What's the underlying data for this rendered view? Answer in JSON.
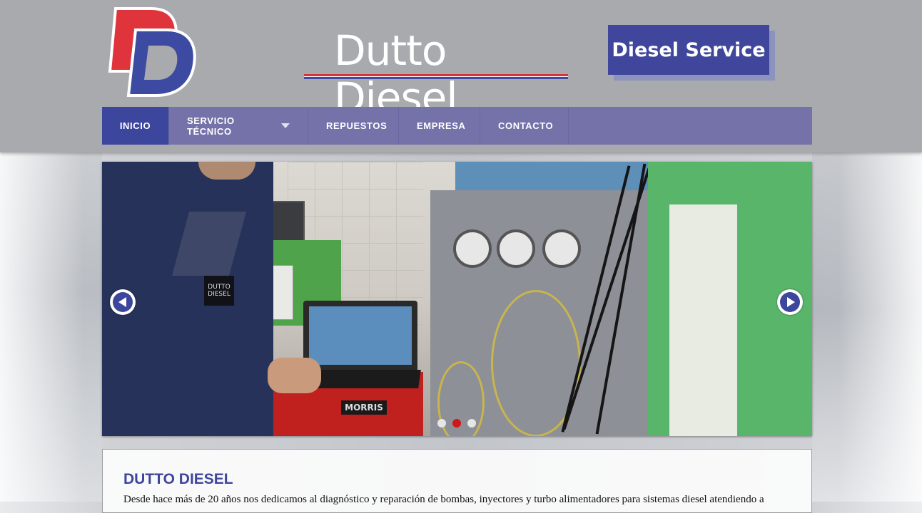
{
  "site": {
    "logo_text": "Dutto Diesel",
    "logo_mark": "DD",
    "badge": "Diesel Service"
  },
  "nav": {
    "items": [
      {
        "label": "INICIO"
      },
      {
        "label": "SERVICIO TÉCNICO"
      },
      {
        "label": "REPUESTOS"
      },
      {
        "label": "EMPRESA"
      },
      {
        "label": "CONTACTO"
      }
    ]
  },
  "slider": {
    "slides": 3,
    "active_slide": 2,
    "cart_label": "MORRIS",
    "patch_text": "DUTTO DIESEL"
  },
  "content": {
    "heading": "DUTTO DIESEL",
    "paragraph": "Desde hace más de 20 años nos dedicamos al diagnóstico y reparación de bombas, inyectores y turbo alimentadores para sistemas diesel atendiendo a"
  },
  "colors": {
    "brand_blue": "#3f469c",
    "nav": "#7472a9",
    "brand_red": "#d8323a"
  }
}
